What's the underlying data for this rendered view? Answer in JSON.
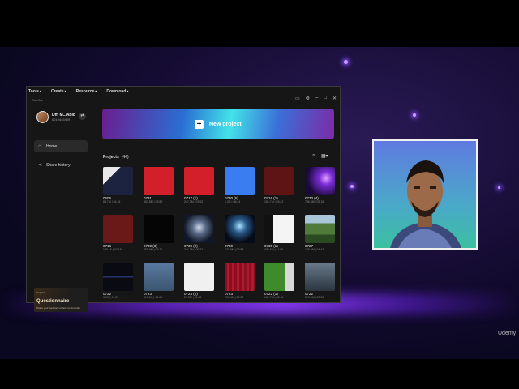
{
  "menu": [
    {
      "label": "Tools"
    },
    {
      "label": "Create"
    },
    {
      "label": "Resource"
    },
    {
      "label": "Download"
    }
  ],
  "app_logo": "CapCut",
  "window_controls": [
    "feedback-icon",
    "settings-icon",
    "minimize-icon",
    "maximize-icon",
    "close-icon"
  ],
  "user": {
    "name": "Dm M...Abid",
    "phone": "6019445469"
  },
  "nav": [
    {
      "label": "Home",
      "icon": "home-icon",
      "active": true
    },
    {
      "label": "Share history",
      "icon": "share-icon",
      "active": false
    }
  ],
  "promo": {
    "tag": "CapCut",
    "title": "Questionnaire",
    "subtitle": "Share your feedback to help us do better"
  },
  "hero": {
    "label": "New project"
  },
  "projects": {
    "label": "Projects",
    "count": "(44)",
    "items": [
      {
        "name": "0506",
        "meta": "84.7M | 01:16",
        "thumb": "screen"
      },
      {
        "name": "0731",
        "meta": "867.8M | 03:52",
        "thumb": "red"
      },
      {
        "name": "0717 (1)",
        "meta": "247.3M | 03:52",
        "thumb": "red"
      },
      {
        "name": "0730 (5)",
        "meta": "1.3G | 06:44",
        "thumb": "blue"
      },
      {
        "name": "0716 (1)",
        "meta": "181.7M | 03:42",
        "thumb": "darkred"
      },
      {
        "name": "0730 (4)",
        "meta": "786.3M | 05:18",
        "thumb": "purple"
      },
      {
        "name": "0716",
        "meta": "166.1K | 03:18",
        "thumb": "darkred2"
      },
      {
        "name": "0730 (3)",
        "meta": "251.9M | 09:16",
        "thumb": "black"
      },
      {
        "name": "0730 (2)",
        "meta": "241.3M | 06:32",
        "thumb": "robot"
      },
      {
        "name": "0730",
        "meta": "627.6M | 05:58",
        "thumb": "tunnel"
      },
      {
        "name": "0730 (1)",
        "meta": "486.5M | 11:08",
        "thumb": "doc"
      },
      {
        "name": "0727",
        "meta": "179.2M | 04:43",
        "thumb": "landscape"
      },
      {
        "name": "0722",
        "meta": "1.1G | 04:33",
        "thumb": "dark"
      },
      {
        "name": "0723",
        "meta": "117.9M | 10:08",
        "thumb": "face"
      },
      {
        "name": "0723 (2)",
        "meta": "21.3M | 01:28",
        "thumb": "white"
      },
      {
        "name": "0723",
        "meta": "208.4M | 05:27",
        "thumb": "curtain"
      },
      {
        "name": "0722 (1)",
        "meta": "162.7M | 08:16",
        "thumb": "green"
      },
      {
        "name": "0722",
        "meta": "213.5M | 05:20",
        "thumb": "face2"
      }
    ]
  },
  "watermark": "Udemy"
}
